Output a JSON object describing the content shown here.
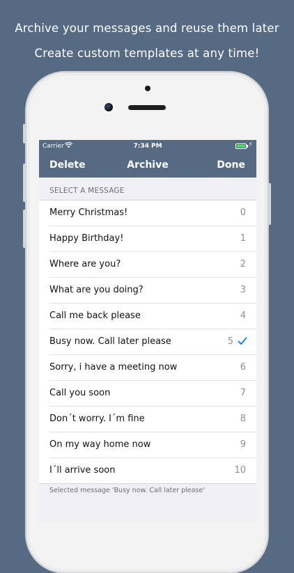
{
  "promo": {
    "line1": "Archive your messages and reuse them later",
    "line2": "Create custom templates at any time!"
  },
  "status_bar": {
    "carrier": "Carrier",
    "time": "7:34 PM"
  },
  "nav": {
    "left": "Delete",
    "title": "Archive",
    "right": "Done"
  },
  "section_header": "SELECT A MESSAGE",
  "messages": [
    {
      "text": "Merry Christmas!",
      "index": "0"
    },
    {
      "text": "Happy Birthday!",
      "index": "1"
    },
    {
      "text": "Where are you?",
      "index": "2"
    },
    {
      "text": "What are you doing?",
      "index": "3"
    },
    {
      "text": "Call me back please",
      "index": "4"
    },
    {
      "text": "Busy now. Call later please",
      "index": "5"
    },
    {
      "text": "Sorry, i have a meeting now",
      "index": "6"
    },
    {
      "text": "Call you soon",
      "index": "7"
    },
    {
      "text": "Don´t worry. I´m fine",
      "index": "8"
    },
    {
      "text": "On my way home now",
      "index": "9"
    },
    {
      "text": "I´ll arrive soon",
      "index": "10"
    }
  ],
  "selected_index": 5,
  "footer": "Selected message 'Busy now. Call later please'",
  "colors": {
    "accent": "#566a84",
    "check": "#007aff"
  }
}
